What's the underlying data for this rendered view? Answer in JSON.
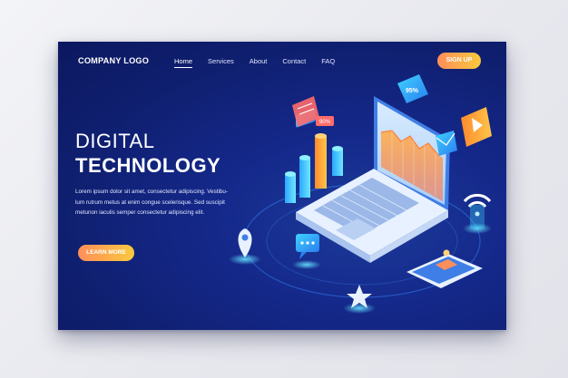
{
  "header": {
    "logo": "COMPANY LOGO",
    "nav": [
      "Home",
      "Services",
      "About",
      "Contact",
      "FAQ"
    ],
    "active_nav": "Home",
    "signup_label": "SIGN UP"
  },
  "hero": {
    "title_line1": "DIGITAL",
    "title_line2": "TECHNOLOGY",
    "body_lines": [
      "Lorem ipsum dolor sit amet, consectetur adipiscing. Vestibu-",
      "lum rutrum metus at enim congue scelerisque. Sed suscipit",
      "metunon iaculis semper consectetur adipiscing elit."
    ],
    "cta_label": "LEARN MORE"
  },
  "illustration": {
    "badge_top": "95%",
    "badge_small": "90%",
    "icons": [
      "bar-chart-icon",
      "laptop-icon",
      "smartphone-icon",
      "location-pin-icon",
      "chat-icon",
      "star-icon",
      "wifi-icon",
      "mail-icon",
      "video-play-icon"
    ]
  },
  "colors": {
    "card_bg": "#14288a",
    "accent_gradient_start": "#ff8e5a",
    "accent_gradient_end": "#f9c93d",
    "cyan": "#3fd3ff",
    "orange": "#ff9f3e"
  }
}
